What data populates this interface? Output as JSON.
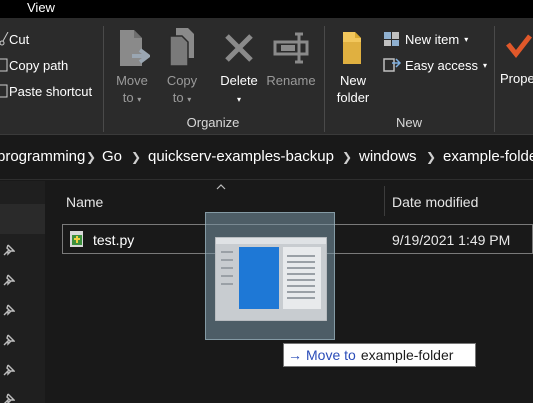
{
  "tabs": {
    "view": "View"
  },
  "clipboard": {
    "cut": "Cut",
    "copy_path": "Copy path",
    "paste_shortcut": "Paste shortcut"
  },
  "organize": {
    "group_label": "Organize",
    "move_to": [
      "Move",
      "to"
    ],
    "copy_to": [
      "Copy",
      "to"
    ],
    "delete": "Delete",
    "rename": "Rename"
  },
  "new_group": {
    "group_label": "New",
    "new_folder": [
      "New",
      "folder"
    ],
    "new_item": "New item",
    "easy_access": "Easy access"
  },
  "open_group": {
    "properties": "Prope"
  },
  "address": {
    "crumbs": [
      "programming",
      "Go",
      "quickserv-examples-backup",
      "windows",
      "example-folder"
    ]
  },
  "list": {
    "columns": {
      "name": "Name",
      "date": "Date modified"
    },
    "rows": [
      {
        "name": "test.py",
        "date": "9/19/2021 1:49 PM"
      }
    ]
  },
  "drag": {
    "verb": "Move to",
    "target": "example-folder"
  },
  "colors": {
    "accent": "#1e78d6",
    "tooltip_verb": "#2a4cb8"
  }
}
